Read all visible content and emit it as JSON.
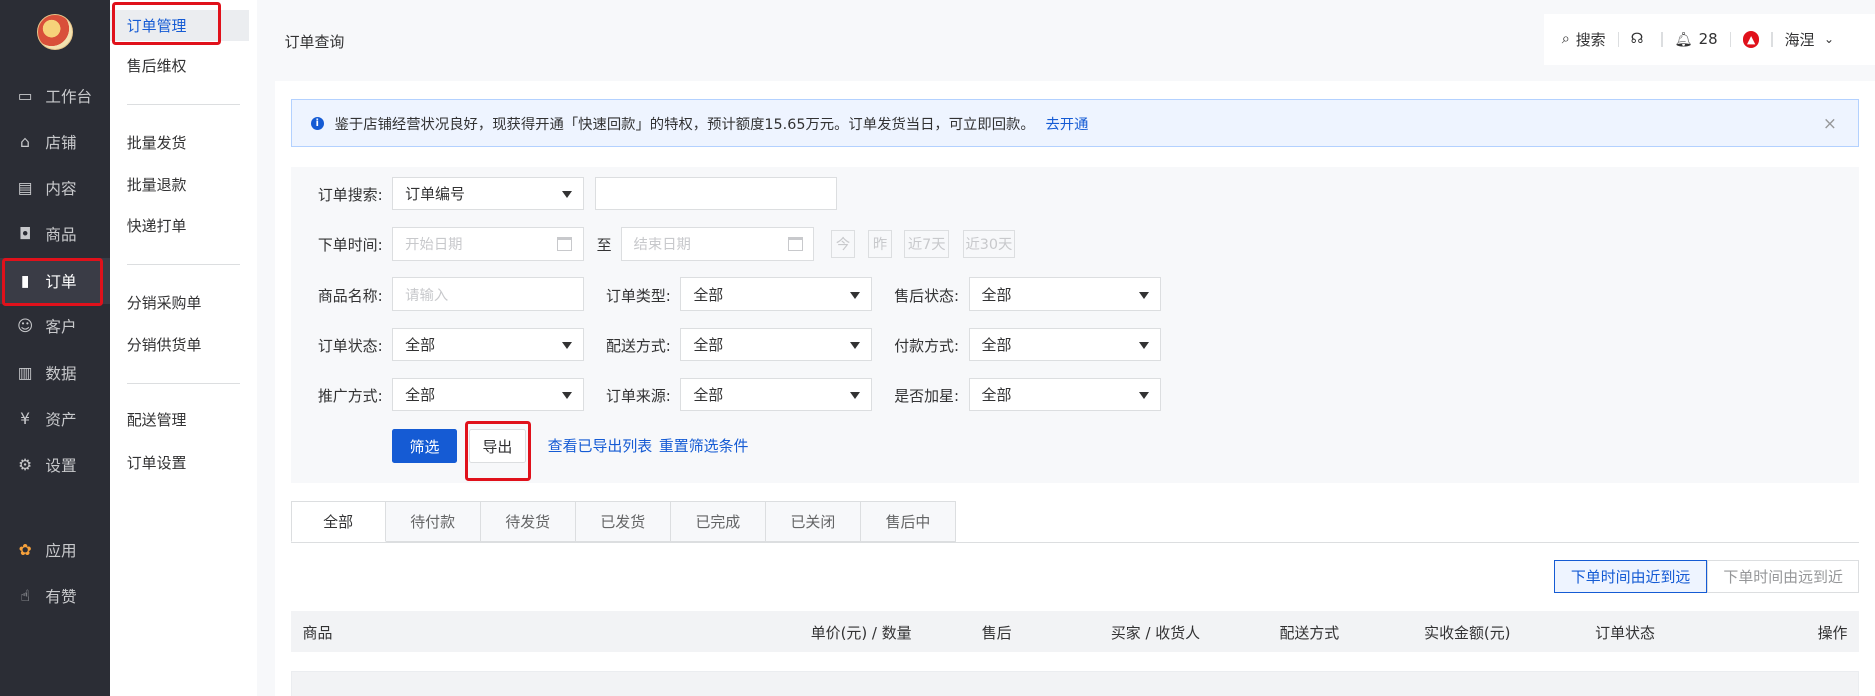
{
  "nav": {
    "items": [
      {
        "label": "工作台",
        "icon": "monitor-icon"
      },
      {
        "label": "店铺",
        "icon": "store-icon"
      },
      {
        "label": "内容",
        "icon": "document-icon"
      },
      {
        "label": "商品",
        "icon": "bag-icon"
      },
      {
        "label": "订单",
        "icon": "order-icon"
      },
      {
        "label": "客户",
        "icon": "user-icon"
      },
      {
        "label": "数据",
        "icon": "bar-chart-icon"
      },
      {
        "label": "资产",
        "icon": "yen-icon"
      },
      {
        "label": "设置",
        "icon": "gear-icon"
      }
    ],
    "bottom": [
      {
        "label": "应用",
        "icon": "apps-icon"
      },
      {
        "label": "有赞",
        "icon": "thumbs-up-icon"
      }
    ]
  },
  "subnav": {
    "groups": [
      [
        "订单管理",
        "售后维权"
      ],
      [
        "批量发货",
        "批量退款",
        "快递打单"
      ],
      [
        "分销采购单",
        "分销供货单"
      ],
      [
        "配送管理",
        "订单设置"
      ]
    ]
  },
  "header": {
    "title": "订单查询",
    "search": "搜索",
    "notifications": "28",
    "user": "海涅"
  },
  "notice": {
    "text": "鉴于店铺经营状况良好，现获得开通「快速回款」的特权，预计额度15.65万元。订单发货当日，可立即回款。",
    "link": "去开通"
  },
  "filters": {
    "order_search_label": "订单搜索:",
    "order_search_type": "订单编号",
    "order_time_label": "下单时间:",
    "start_placeholder": "开始日期",
    "to": "至",
    "end_placeholder": "结束日期",
    "quick": [
      "今",
      "昨",
      "近7天",
      "近30天"
    ],
    "product_label": "商品名称:",
    "product_placeholder": "请输入",
    "order_type_label": "订单类型:",
    "order_type_value": "全部",
    "aftersale_label": "售后状态:",
    "aftersale_value": "全部",
    "order_status_label": "订单状态:",
    "order_status_value": "全部",
    "delivery_label": "配送方式:",
    "delivery_value": "全部",
    "payment_label": "付款方式:",
    "payment_value": "全部",
    "promo_label": "推广方式:",
    "promo_value": "全部",
    "source_label": "订单来源:",
    "source_value": "全部",
    "star_label": "是否加星:",
    "star_value": "全部",
    "filter_button": "筛选",
    "export_button": "导出",
    "view_exports": "查看已导出列表",
    "reset": "重置筛选条件"
  },
  "tabs": [
    "全部",
    "待付款",
    "待发货",
    "已发货",
    "已完成",
    "已关闭",
    "售后中"
  ],
  "sort": {
    "near_to_far": "下单时间由近到远",
    "far_to_near": "下单时间由远到近"
  },
  "table": {
    "headers": [
      "商品",
      "单价(元) / 数量",
      "售后",
      "买家 / 收货人",
      "配送方式",
      "实收金额(元)",
      "订单状态",
      "操作"
    ]
  },
  "colors": {
    "accent": "#155bd4",
    "highlight": "#e0111b",
    "sidebar": "#2b2d35"
  }
}
